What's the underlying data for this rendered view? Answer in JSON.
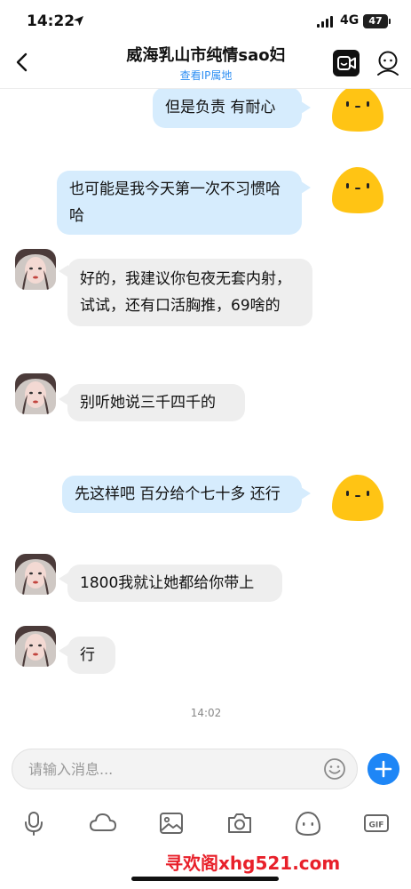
{
  "status_bar": {
    "time": "14:22",
    "network": "4G",
    "battery": "47"
  },
  "header": {
    "title": "威海乳山市纯情sao妇",
    "subtitle": "查看IP属地"
  },
  "messages": [
    {
      "side": "out",
      "text": "但是负责 有耐心"
    },
    {
      "side": "out",
      "text": "也可能是我今天第一次不习惯哈哈"
    },
    {
      "side": "in",
      "text": "好的，我建议你包夜无套内射，试试，还有口活胸推，69啥的"
    },
    {
      "side": "in",
      "text": "别听她说三千四千的"
    },
    {
      "side": "out",
      "text": "先这样吧 百分给个七十多 还行"
    },
    {
      "side": "in",
      "text": "1800我就让她都给你带上"
    },
    {
      "side": "in",
      "text": "行"
    }
  ],
  "timestamp": "14:02",
  "input": {
    "placeholder": "请输入消息..."
  },
  "toolbar": {
    "items": [
      "microphone-icon",
      "cloud-icon",
      "image-icon",
      "camera-icon",
      "sticker-icon",
      "gif-icon"
    ],
    "gif_label": "GIF"
  },
  "watermark": "寻欢阁xhg521.com",
  "colors": {
    "accent": "#1e86f6",
    "outgoing_bubble": "#d6ecfd",
    "incoming_bubble": "#eeeeee",
    "watermark": "#e8202a"
  }
}
